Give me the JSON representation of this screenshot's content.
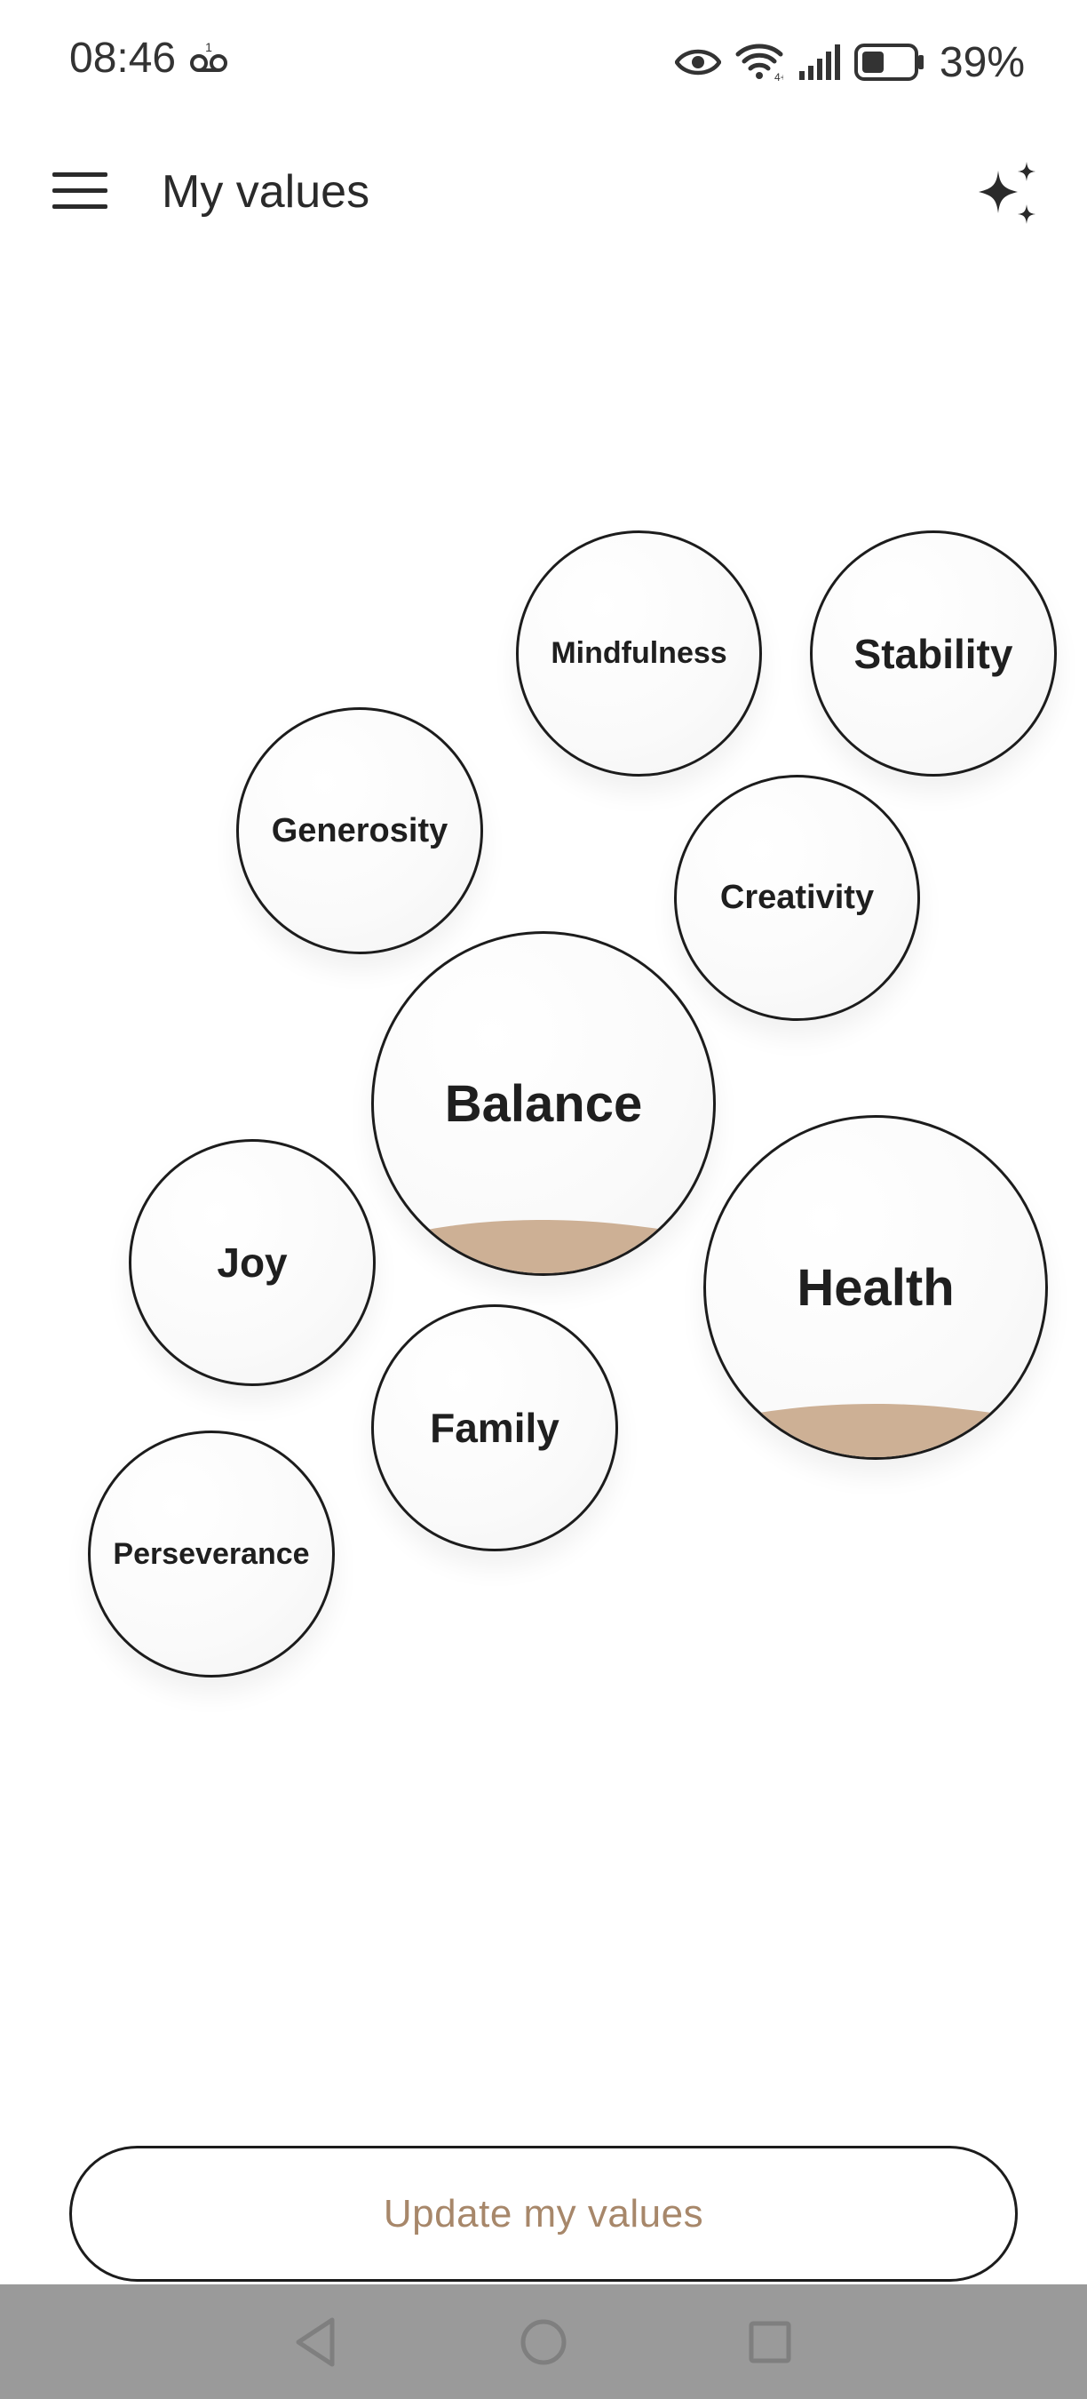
{
  "status_bar": {
    "time": "08:46",
    "battery_percent": "39%",
    "icons": [
      "voicemail-icon",
      "eye-icon",
      "wifi-icon",
      "signal-icon",
      "battery-icon"
    ]
  },
  "app_bar": {
    "title": "My values",
    "menu_icon": "hamburger-menu-icon",
    "action_icon": "sparkle-icon"
  },
  "values": [
    {
      "label": "Mindfulness",
      "filled": false
    },
    {
      "label": "Stability",
      "filled": false
    },
    {
      "label": "Generosity",
      "filled": false
    },
    {
      "label": "Creativity",
      "filled": false
    },
    {
      "label": "Balance",
      "filled": true
    },
    {
      "label": "Health",
      "filled": true
    },
    {
      "label": "Joy",
      "filled": false
    },
    {
      "label": "Family",
      "filled": false
    },
    {
      "label": "Perseverance",
      "filled": false
    }
  ],
  "colors": {
    "fill": "#cdb095",
    "accent_text": "#a7876a",
    "outline": "#1c1c1c",
    "nav_bar": "#9a9a9a"
  },
  "update_button": {
    "label": "Update my values"
  },
  "nav_bar": {
    "icons": [
      "back-icon",
      "home-icon",
      "recents-icon"
    ]
  }
}
